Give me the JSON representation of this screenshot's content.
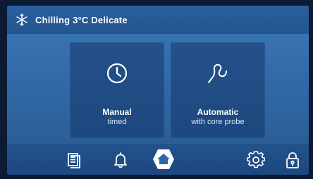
{
  "header": {
    "title": "Chilling 3°C Delicate",
    "icon": "snowflake-icon"
  },
  "cards": [
    {
      "label": "Manual",
      "sub": "timed",
      "icon": "clock-icon"
    },
    {
      "label": "Automatic",
      "sub": "with core probe",
      "icon": "core-probe-icon"
    }
  ],
  "nav": {
    "items": [
      "documents-icon",
      "bell-icon",
      "home-icon",
      "gear-icon",
      "lock-icon"
    ],
    "active": "home-icon"
  },
  "colors": {
    "background": "#3b78b8",
    "bars": "#24558f",
    "home_active": "#ffffff",
    "icon": "#ffffff"
  }
}
